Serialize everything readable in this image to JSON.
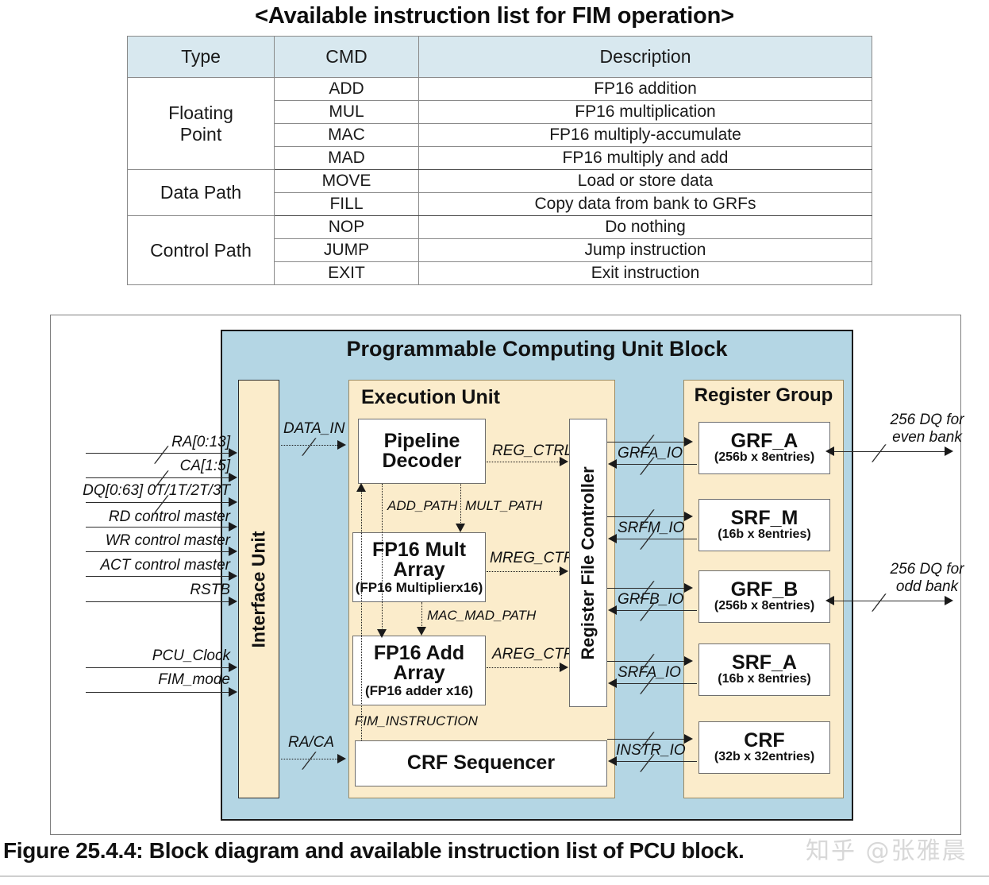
{
  "table": {
    "title": "<Available instruction list for FIM operation>",
    "headers": [
      "Type",
      "CMD",
      "Description"
    ],
    "groups": [
      {
        "type": "Floating Point",
        "type_lines": [
          "Floating",
          "Point"
        ],
        "rows": [
          {
            "cmd": "ADD",
            "desc": "FP16 addition"
          },
          {
            "cmd": "MUL",
            "desc": "FP16 multiplication"
          },
          {
            "cmd": "MAC",
            "desc": "FP16 multiply-accumulate"
          },
          {
            "cmd": "MAD",
            "desc": "FP16 multiply and add"
          }
        ]
      },
      {
        "type": "Data Path",
        "type_lines": [
          "Data Path"
        ],
        "rows": [
          {
            "cmd": "MOVE",
            "desc": "Load or store data"
          },
          {
            "cmd": "FILL",
            "desc": "Copy data from bank to GRFs"
          }
        ]
      },
      {
        "type": "Control Path",
        "type_lines": [
          "Control Path"
        ],
        "rows": [
          {
            "cmd": "NOP",
            "desc": "Do nothing"
          },
          {
            "cmd": "JUMP",
            "desc": "Jump instruction"
          },
          {
            "cmd": "EXIT",
            "desc": "Exit instruction"
          }
        ]
      }
    ]
  },
  "diagram": {
    "pcu_title": "Programmable Computing Unit Block",
    "interface_unit": "Interface Unit",
    "execution_unit": "Execution Unit",
    "register_file_controller": "Register File Controller",
    "register_group": "Register Group",
    "inputs": [
      "RA[0:13]",
      "CA[1:5]",
      "DQ[0:63] 0T/1T/2T/3T",
      "RD control master",
      "WR control master",
      "ACT control master",
      "RSTB",
      "PCU_Clock",
      "FIM_mode"
    ],
    "iface_out": [
      {
        "label": "DATA_IN"
      },
      {
        "label": "RA/CA"
      }
    ],
    "exec_blocks": {
      "pipeline_decoder": {
        "line1": "Pipeline",
        "line2": "Decoder"
      },
      "fp16_mult": {
        "line1": "FP16 Mult",
        "line2": "Array",
        "sub": "(FP16 Multiplierx16)"
      },
      "fp16_add": {
        "line1": "FP16 Add",
        "line2": "Array",
        "sub": "(FP16 adder x16)"
      },
      "crf_sequencer": {
        "line1": "CRF Sequencer"
      }
    },
    "path_labels": {
      "add_path": "ADD_PATH",
      "mult_path": "MULT_PATH",
      "mac_mad_path": "MAC_MAD_PATH",
      "fim_instruction": "FIM_INSTRUCTION"
    },
    "ctrl_labels": {
      "reg_ctrl": "REG_CTRL",
      "mreg_ctrl": "MREG_CTRL",
      "areg_ctrl": "AREG_CTRL"
    },
    "registers": [
      {
        "name": "GRF_A",
        "spec": "(256b x 8entries)",
        "io": "GRFA_IO"
      },
      {
        "name": "SRF_M",
        "spec": "(16b x 8entries)",
        "io": "SRFM_IO"
      },
      {
        "name": "GRF_B",
        "spec": "(256b x 8entries)",
        "io": "GRFB_IO"
      },
      {
        "name": "SRF_A",
        "spec": "(16b x 8entries)",
        "io": "SRFA_IO"
      },
      {
        "name": "CRF",
        "spec": "(32b x 32entries)",
        "io": "INSTR_IO"
      }
    ],
    "bank_labels": [
      {
        "line1": "256 DQ for",
        "line2": "even bank"
      },
      {
        "line1": "256 DQ for",
        "line2": "odd bank"
      }
    ],
    "colors": {
      "pcu_blue": "#b4d6e4",
      "block_cream": "#fbeccb",
      "table_header": "#d8e8ef",
      "line": "#2b2b2b"
    }
  },
  "caption": "Figure 25.4.4: Block diagram and available instruction list of PCU block.",
  "watermark": "知乎 @张雅晨"
}
